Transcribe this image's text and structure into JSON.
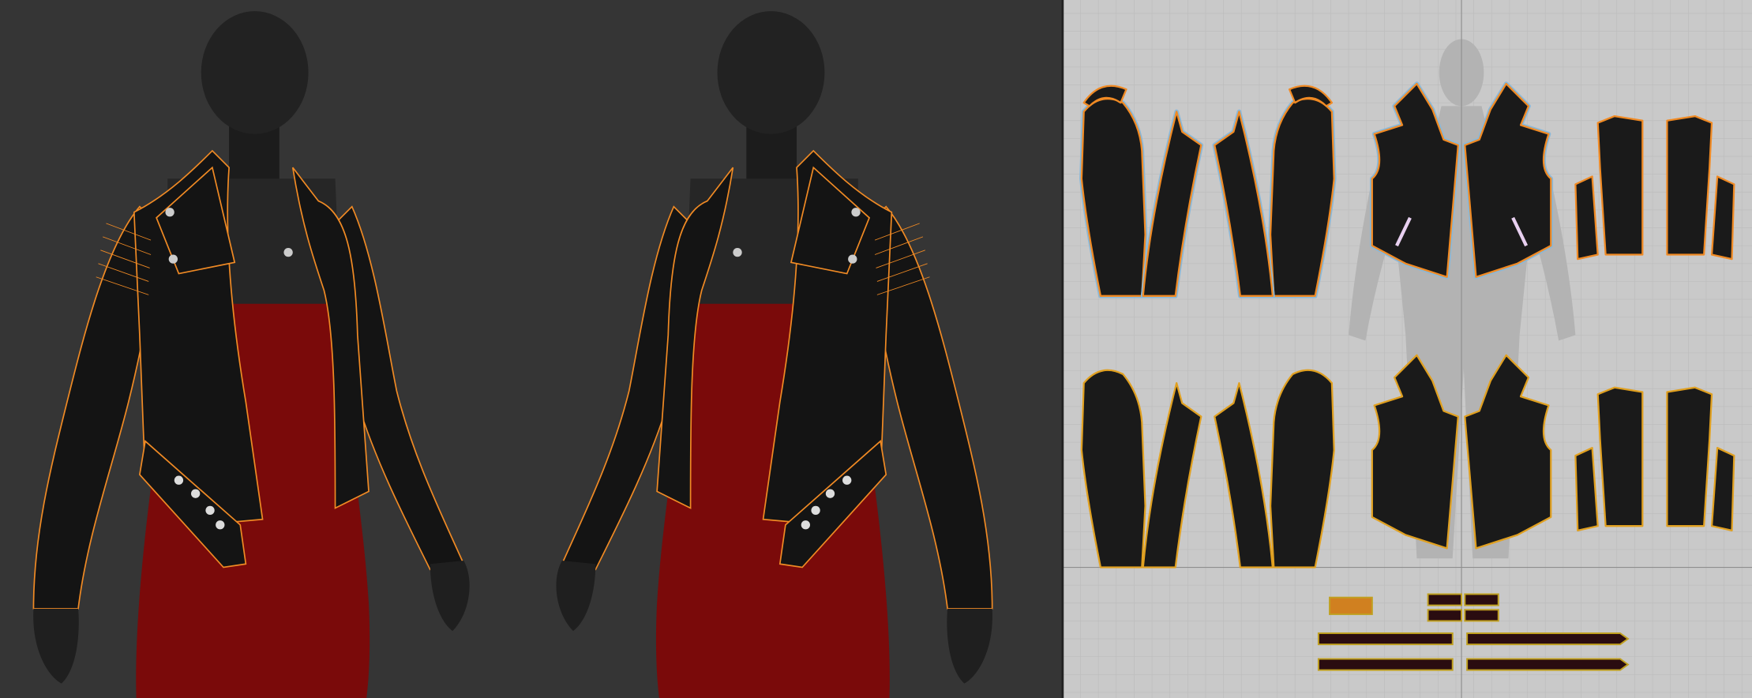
{
  "viewport_3d": {
    "background": "#353535",
    "avatar_color": "#1f1f1f",
    "dress_color": "#7a0a0a",
    "jacket_color": "#141414",
    "stitch_color": "#f08a24"
  },
  "viewport_2d": {
    "background": "#c9c9c9",
    "grid_color": "#bdbdbd",
    "axis_color": "#8e8e8e",
    "piece_fill": "#1a1a1a",
    "piece_outline": "#f08a24",
    "selection_halo": "#8ab8d8",
    "silhouette_color": "#b3b3b3"
  }
}
